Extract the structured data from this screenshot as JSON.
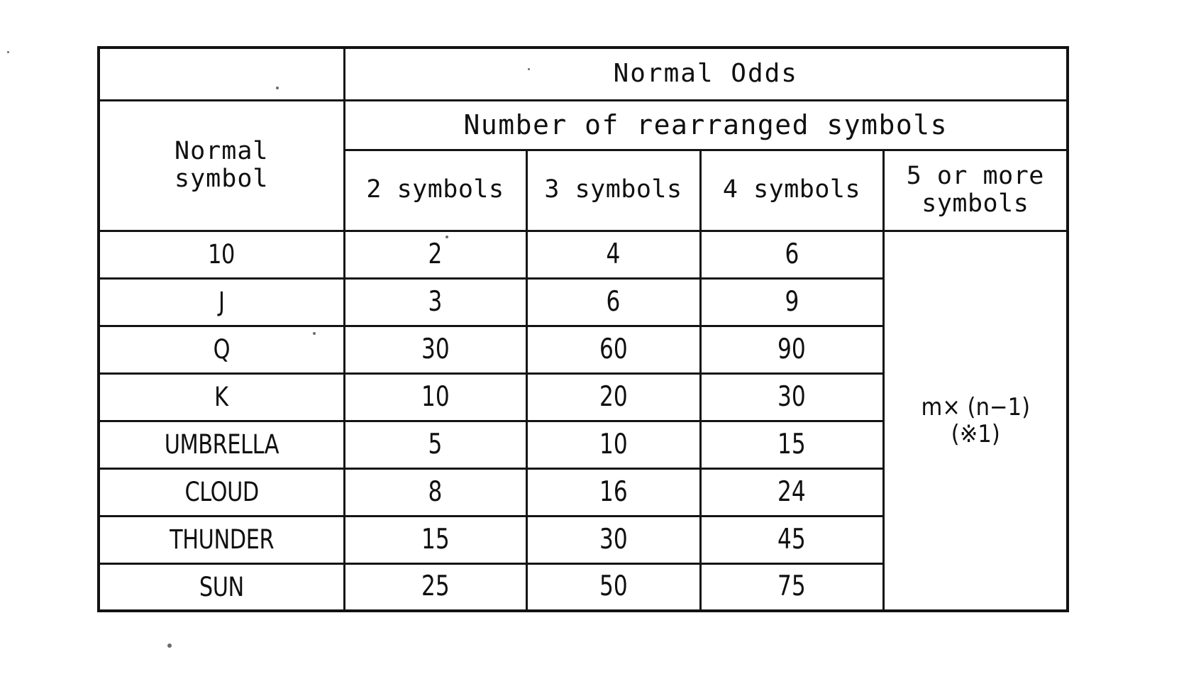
{
  "figure": {
    "table_title_top": "Normal Odds",
    "table_title_sub": "Number of rearranged symbols",
    "row_header_line1": "Normal",
    "row_header_line2": "symbol"
  },
  "columns": {
    "symbol_header": "Normal symbol",
    "c2": "2 symbols",
    "c3": "3 symbols",
    "c4": "4 symbols",
    "c5_line1": "5 or more",
    "c5_line2": "symbols",
    "c5_full": "5 or more symbols"
  },
  "five_or_more": {
    "formula_line1": "m× (n−1)",
    "formula_line2": "(※1)"
  },
  "chart_data": {
    "type": "table",
    "title": "Normal Odds",
    "subtitle": "Number of rearranged symbols",
    "row_header": "Normal symbol",
    "columns": [
      "2 symbols",
      "3 symbols",
      "4 symbols",
      "5 or more symbols"
    ],
    "rows": [
      {
        "symbol": "10",
        "c2": "2",
        "c3": "4",
        "c4": "6"
      },
      {
        "symbol": "J",
        "c2": "3",
        "c3": "6",
        "c4": "9"
      },
      {
        "symbol": "Q",
        "c2": "30",
        "c3": "60",
        "c4": "90"
      },
      {
        "symbol": "K",
        "c2": "10",
        "c3": "20",
        "c4": "30"
      },
      {
        "symbol": "UMBRELLA",
        "c2": "5",
        "c3": "10",
        "c4": "15"
      },
      {
        "symbol": "CLOUD",
        "c2": "8",
        "c3": "16",
        "c4": "24"
      },
      {
        "symbol": "THUNDER",
        "c2": "15",
        "c3": "30",
        "c4": "45"
      },
      {
        "symbol": "SUN",
        "c2": "25",
        "c3": "50",
        "c4": "75"
      }
    ],
    "merged_cell": "m× (n−1) (※1)",
    "notes": "Rightmost column '5 or more symbols' is a single merged cell spanning all 8 data rows."
  },
  "colors": {
    "ink": "#101010",
    "paper": "#ffffff"
  }
}
